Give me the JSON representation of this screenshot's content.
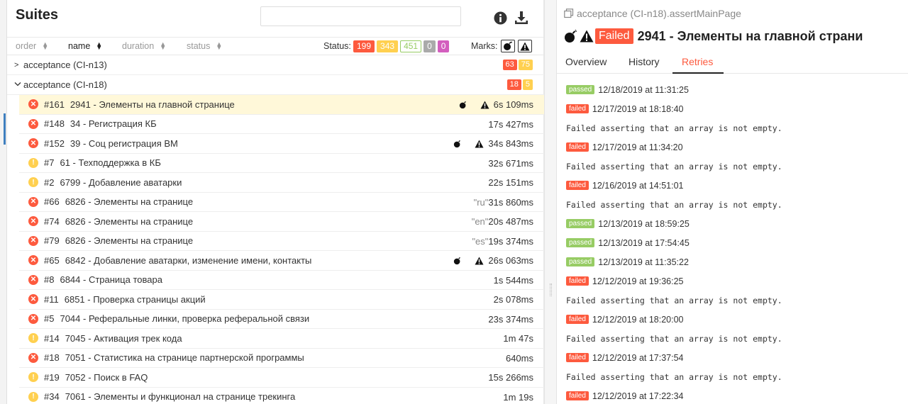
{
  "header": {
    "title": "Suites",
    "search_placeholder": ""
  },
  "sortbar": {
    "order": "order",
    "name": "name",
    "duration": "duration",
    "status": "status",
    "status_label": "Status:",
    "counts": {
      "failed": "199",
      "broken": "343",
      "passed": "451",
      "skipped": "0",
      "unknown": "0"
    },
    "marks_label": "Marks:"
  },
  "groups": [
    {
      "name": "acceptance (CI-n13)",
      "failed": "63",
      "broken": "75"
    },
    {
      "name": "acceptance (CI-n18)",
      "failed": "18",
      "broken": "5"
    }
  ],
  "tests": [
    {
      "status": "failed",
      "order": "#161",
      "name": "2941 - Элементы на главной странице",
      "param": "",
      "duration": "6s 109ms",
      "flaky": true,
      "newfail": true
    },
    {
      "status": "failed",
      "order": "#148",
      "name": "34 - Регистрация КБ",
      "param": "",
      "duration": "17s 427ms",
      "flaky": false,
      "newfail": false
    },
    {
      "status": "failed",
      "order": "#152",
      "name": "39 - Соц регистрация ВМ",
      "param": "",
      "duration": "34s 843ms",
      "flaky": true,
      "newfail": true
    },
    {
      "status": "broken",
      "order": "#7",
      "name": "61 - Техподдержка в КБ",
      "param": "",
      "duration": "32s 671ms",
      "flaky": false,
      "newfail": false
    },
    {
      "status": "broken",
      "order": "#2",
      "name": "6799 - Добавление аватарки",
      "param": "",
      "duration": "22s 151ms",
      "flaky": false,
      "newfail": false
    },
    {
      "status": "failed",
      "order": "#66",
      "name": "6826 - Элементы на странице",
      "param": "\"ru\"",
      "duration": "31s 860ms",
      "flaky": false,
      "newfail": false
    },
    {
      "status": "failed",
      "order": "#74",
      "name": "6826 - Элементы на странице",
      "param": "\"en\"",
      "duration": "20s 487ms",
      "flaky": false,
      "newfail": false
    },
    {
      "status": "failed",
      "order": "#79",
      "name": "6826 - Элементы на странице",
      "param": "\"es\"",
      "duration": "19s 374ms",
      "flaky": false,
      "newfail": false
    },
    {
      "status": "failed",
      "order": "#65",
      "name": "6842 - Добавление аватарки, изменение имени, контакты",
      "param": "",
      "duration": "26s 063ms",
      "flaky": true,
      "newfail": true
    },
    {
      "status": "failed",
      "order": "#8",
      "name": "6844 - Страница товара",
      "param": "",
      "duration": "1s 544ms",
      "flaky": false,
      "newfail": false
    },
    {
      "status": "failed",
      "order": "#11",
      "name": "6851 - Проверка страницы акций",
      "param": "",
      "duration": "2s 078ms",
      "flaky": false,
      "newfail": false
    },
    {
      "status": "failed",
      "order": "#5",
      "name": "7044 - Реферальные линки, проверка реферальной связи",
      "param": "",
      "duration": "23s 374ms",
      "flaky": false,
      "newfail": false
    },
    {
      "status": "broken",
      "order": "#14",
      "name": "7045 - Активация трек кода",
      "param": "",
      "duration": "1m 47s",
      "flaky": false,
      "newfail": false
    },
    {
      "status": "failed",
      "order": "#18",
      "name": "7051 - Статистика на странице партнерской программы",
      "param": "",
      "duration": "640ms",
      "flaky": false,
      "newfail": false
    },
    {
      "status": "broken",
      "order": "#19",
      "name": "7052 - Поиск в FAQ",
      "param": "",
      "duration": "15s 266ms",
      "flaky": false,
      "newfail": false
    },
    {
      "status": "broken",
      "order": "#34",
      "name": "7061 - Элементы и функционал на странице трекинга",
      "param": "",
      "duration": "1m 19s",
      "flaky": false,
      "newfail": false
    }
  ],
  "detail": {
    "breadcrumb": "acceptance (CI-n18).assertMainPage",
    "status_badge": "Failed",
    "title": "2941 - Элементы на главной страни",
    "tabs": [
      "Overview",
      "History",
      "Retries"
    ],
    "retries": [
      {
        "status": "passed",
        "time": "12/18/2019 at 11:31:25",
        "message": ""
      },
      {
        "status": "failed",
        "time": "12/17/2019 at 18:18:40",
        "message": "Failed asserting that an array is not empty."
      },
      {
        "status": "failed",
        "time": "12/17/2019 at 11:34:20",
        "message": "Failed asserting that an array is not empty."
      },
      {
        "status": "failed",
        "time": "12/16/2019 at 14:51:01",
        "message": "Failed asserting that an array is not empty."
      },
      {
        "status": "passed",
        "time": "12/13/2019 at 18:59:25",
        "message": ""
      },
      {
        "status": "passed",
        "time": "12/13/2019 at 17:54:45",
        "message": ""
      },
      {
        "status": "passed",
        "time": "12/13/2019 at 11:35:22",
        "message": ""
      },
      {
        "status": "failed",
        "time": "12/12/2019 at 19:36:25",
        "message": "Failed asserting that an array is not empty."
      },
      {
        "status": "failed",
        "time": "12/12/2019 at 18:20:00",
        "message": "Failed asserting that an array is not empty."
      },
      {
        "status": "failed",
        "time": "12/12/2019 at 17:37:54",
        "message": "Failed asserting that an array is not empty."
      },
      {
        "status": "failed",
        "time": "12/12/2019 at 17:22:34",
        "message": ""
      }
    ]
  }
}
